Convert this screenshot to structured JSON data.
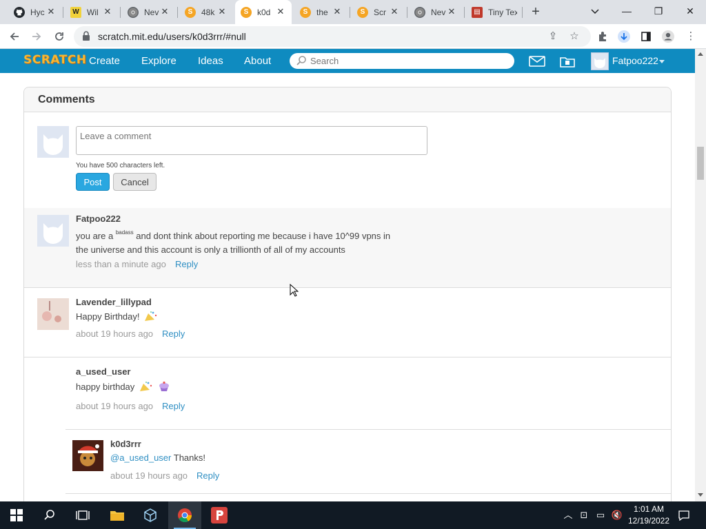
{
  "browser": {
    "tabs": [
      {
        "label": "Hyc",
        "icon": "github-icon",
        "active": false
      },
      {
        "label": "Wil",
        "icon": "site-icon",
        "active": false
      },
      {
        "label": "Nev",
        "icon": "chrome-icon",
        "active": false
      },
      {
        "label": "48k",
        "icon": "scratch-icon",
        "active": false
      },
      {
        "label": "k0d",
        "icon": "scratch-icon",
        "active": true
      },
      {
        "label": "the",
        "icon": "scratch-icon",
        "active": false
      },
      {
        "label": "Scr",
        "icon": "scratch-icon",
        "active": false
      },
      {
        "label": "Nev",
        "icon": "chrome-icon",
        "active": false
      },
      {
        "label": "Tiny Tex",
        "icon": "document-icon",
        "active": false
      }
    ],
    "url": "scratch.mit.edu/users/k0d3rrr/#null"
  },
  "scratch_nav": {
    "logo": "SCRATCH",
    "links": [
      "Create",
      "Explore",
      "Ideas",
      "About"
    ],
    "search_placeholder": "Search",
    "username": "Fatpoo222"
  },
  "comments_section": {
    "title": "Comments",
    "input_placeholder": "Leave a comment",
    "chars_left": "You have 500 characters left.",
    "post_label": "Post",
    "cancel_label": "Cancel",
    "comments": [
      {
        "user": "Fatpoo222",
        "text_before_sup": "you are a ",
        "sup": "badass",
        "text_after_sup": " and dont think about reporting me because i have 10^99 vpns in",
        "text_line2": "the universe and this account is only a trillionth of all of my accounts",
        "time": "less than a minute ago",
        "reply": "Reply"
      },
      {
        "user": "Lavender_lillypad",
        "text": "Happy Birthday!",
        "time": "about 19 hours ago",
        "reply": "Reply"
      },
      {
        "user": "a_used_user",
        "text": "happy birthday",
        "time": "about 19 hours ago",
        "reply": "Reply"
      },
      {
        "user": "k0d3rrr",
        "mention": "@a_used_user",
        "text": " Thanks!",
        "time": "about 19 hours ago",
        "reply": "Reply"
      }
    ]
  },
  "taskbar": {
    "time": "1:01 AM",
    "date": "12/19/2022"
  },
  "colors": {
    "scratch_blue": "#0f8bc0",
    "link_blue": "#2f8fc3",
    "post_blue": "#2aa7e0"
  }
}
